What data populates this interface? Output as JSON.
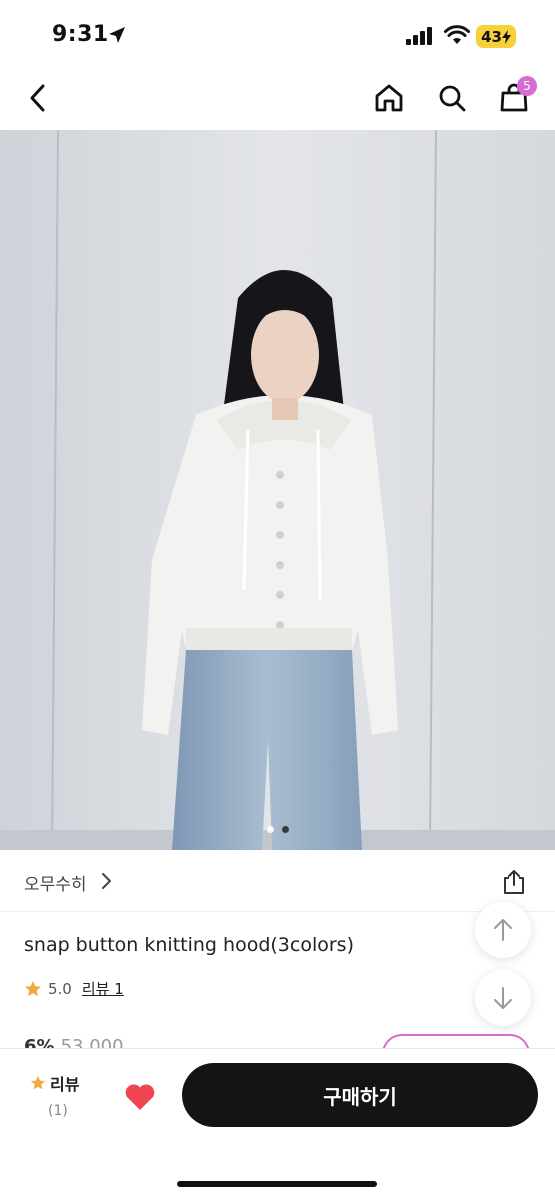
{
  "status_bar": {
    "time": "9:31",
    "battery": "43"
  },
  "nav": {
    "cart_count": "5",
    "icons": [
      "chevron-left-icon",
      "home-icon",
      "search-icon",
      "shopping-bag-icon"
    ]
  },
  "gallery": {
    "image_count": 2,
    "active_index": 0
  },
  "brand": {
    "name": "오무수히"
  },
  "product": {
    "title": "snap button knitting hood(3colors)",
    "rating": "5.0",
    "review_link": "리뷰 1",
    "discount_peek": "6%",
    "original_price_peek": "53,000"
  },
  "bottom_bar": {
    "review_label": "리뷰",
    "review_count": "(1)",
    "buy_label": "구매하기"
  },
  "colors": {
    "accent": "#d86ad4",
    "star": "#f0a93b",
    "heart": "#f04452",
    "buy_button": "#141414"
  }
}
